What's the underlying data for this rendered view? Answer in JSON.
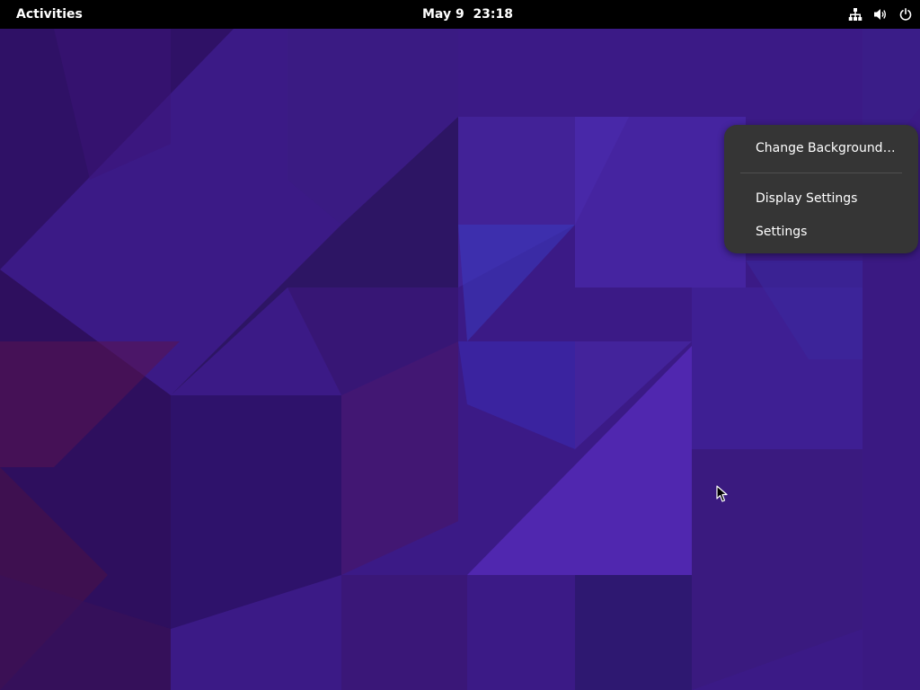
{
  "topbar": {
    "activities_label": "Activities",
    "clock_text": "May 9  23:18",
    "tray_icons": [
      "network-wired-icon",
      "volume-icon",
      "power-icon"
    ]
  },
  "context_menu": {
    "items": [
      {
        "label": "Change Background…"
      },
      {
        "label": "Display Settings"
      },
      {
        "label": "Settings"
      }
    ]
  },
  "colors": {
    "topbar_bg": "#000000",
    "menu_bg": "#353535",
    "menu_text": "#ffffff",
    "wallpaper_base": "#3a1a8a"
  }
}
